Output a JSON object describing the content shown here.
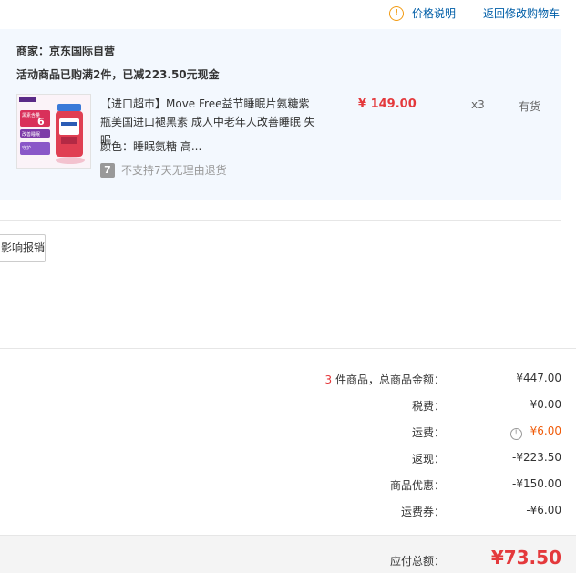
{
  "header": {
    "price_note_label": "价格说明",
    "back_to_cart_label": "返回修改购物车",
    "colors": {
      "link": "#005ea7",
      "warning": "#f29b13"
    },
    "icons": {
      "price_note": "info-circle-icon"
    }
  },
  "shop": {
    "merchant": "商家：京东国际自营",
    "promo": "活动商品已购满2件，已减223.50元现金",
    "background": "#f3f8fe"
  },
  "product": {
    "name": "【进口超市】Move Free益节睡眠片氨糖紫瓶美国进口褪黑素 成人中老年人改善睡眠 失眠",
    "price": "¥ 149.00",
    "quantity": "x3",
    "stock": "有货",
    "color": "颜色：睡眠氨糖 高...",
    "return_policy": "不支持7天无理由退货",
    "return_icon_text": "7",
    "thumb_texts": [
      "黑素含量",
      "6",
      "改善睡眠",
      "守护"
    ],
    "price_color": "#e4393c"
  },
  "reimburse_button": "影响报销",
  "summary": {
    "count": "3",
    "count_suffix": " 件商品，总商品金额：",
    "rows": [
      {
        "label": "税费：",
        "value": "¥0.00"
      },
      {
        "label": "运费：",
        "value": "¥6.00"
      },
      {
        "label": "返现：",
        "value": "-¥223.50"
      },
      {
        "label": "商品优惠：",
        "value": "-¥150.00"
      },
      {
        "label": "运费券：",
        "value": "-¥6.00"
      }
    ],
    "total_goods": "¥447.00",
    "shipping_warning_icon": "!",
    "colors": {
      "accent": "#e4393c",
      "shipping": "#f05b09"
    }
  },
  "total": {
    "label": "应付总额：",
    "value": "¥73.50"
  }
}
